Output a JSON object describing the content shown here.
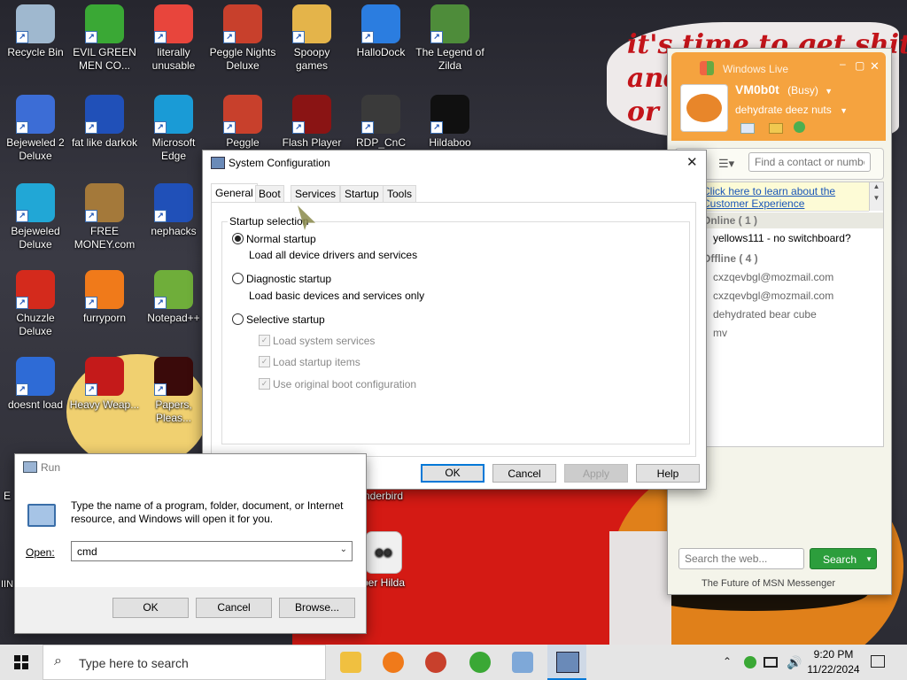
{
  "wallpaper": {
    "text": "it's time to get shit\nand\nor t"
  },
  "desktop_icons": [
    {
      "label": "Recycle Bin",
      "icon": "recycle-bin-icon",
      "color": "#9fb8cf"
    },
    {
      "label": "EVIL GREEN MEN CO...",
      "icon": "msn-people-icon",
      "color": "#3aa835"
    },
    {
      "label": "literally unusable",
      "icon": "chrome-icon",
      "color": "#e8453c"
    },
    {
      "label": "Peggle Nights Deluxe",
      "icon": "peggle-icon",
      "color": "#c8402c"
    },
    {
      "label": "Spoopy games",
      "icon": "folder-icon",
      "color": "#e4b44a"
    },
    {
      "label": "HalloDock",
      "icon": "windows-shield-icon",
      "color": "#2b7de0"
    },
    {
      "label": "The Legend of Zilda",
      "icon": "zilda-icon",
      "color": "#4e8c3a"
    },
    {
      "label": "Bejeweled 2 Deluxe",
      "icon": "bejeweled-icon",
      "color": "#3c6dd6"
    },
    {
      "label": "fat like darkok",
      "icon": "mpi-icon",
      "color": "#2050b8"
    },
    {
      "label": "Microsoft Edge",
      "icon": "edge-icon",
      "color": "#1a9bd6"
    },
    {
      "label": "Peggle World...",
      "icon": "peggle-world-icon",
      "color": "#c8402c"
    },
    {
      "label": "Flash Player",
      "icon": "flash-icon",
      "color": "#8a1414"
    },
    {
      "label": "RDP_CnC",
      "icon": "rdp-icon",
      "color": "#3a3a3a"
    },
    {
      "label": "Hildaboo",
      "icon": "yashma-icon",
      "color": "#101010"
    },
    {
      "label": "Bejeweled Deluxe",
      "icon": "gem-icon",
      "color": "#21a7d6"
    },
    {
      "label": "FREE MONEY.com",
      "icon": "money-bag-icon",
      "color": "#a4793a"
    },
    {
      "label": "nephacks",
      "icon": "mpi-blue-icon",
      "color": "#2050b8"
    },
    {
      "label": "Chuzzle Deluxe",
      "icon": "chuzzle-icon",
      "color": "#d42a1c"
    },
    {
      "label": "furryporn",
      "icon": "firefox-icon",
      "color": "#f07a1a"
    },
    {
      "label": "Notepad++",
      "icon": "notepadpp-icon",
      "color": "#6fae3a"
    },
    {
      "label": "doesnt load",
      "icon": "thunderbird-icon",
      "color": "#2e6bd6"
    },
    {
      "label": "Heavy Weap...",
      "icon": "radiation-icon",
      "color": "#c41a1a"
    },
    {
      "label": "Papers, Pleas...",
      "icon": "papers-icon",
      "color": "#3a0a0a"
    }
  ],
  "partial_labels": {
    "thunderbird": "nderbird",
    "hilda": "per Hilda",
    "left1": "E",
    "left2": "IIN"
  },
  "msconfig": {
    "title": "System Configuration",
    "tabs": [
      "General",
      "Boot",
      "Services",
      "Startup",
      "Tools"
    ],
    "active_tab": "General",
    "group_label": "Startup selection",
    "options": [
      {
        "label": "Normal startup",
        "desc": "Load all device drivers and services",
        "checked": true
      },
      {
        "label": "Diagnostic startup",
        "desc": "Load basic devices and services only",
        "checked": false
      },
      {
        "label": "Selective startup",
        "desc": "",
        "checked": false
      }
    ],
    "sub_options": [
      "Load system services",
      "Load startup items",
      "Use original boot configuration"
    ],
    "buttons": {
      "ok": "OK",
      "cancel": "Cancel",
      "apply": "Apply",
      "help": "Help"
    }
  },
  "run": {
    "title": "Run",
    "description": "Type the name of a program, folder, document, or Internet resource, and Windows will open it for you.",
    "open_label": "Open:",
    "value": "cmd",
    "buttons": {
      "ok": "OK",
      "cancel": "Cancel",
      "browse": "Browse..."
    }
  },
  "msn": {
    "app_title": "Windows Live",
    "user": "VM0b0t",
    "status": "(Busy)",
    "personal_message": "dehydrate deez nuts",
    "search_contacts_placeholder": "Find a contact or number...",
    "banner_line1": "Click here to learn about the",
    "banner_line2": "Customer Experience",
    "online_header": "Online ( 1 )",
    "online_contacts": [
      "yellows111 - no switchboard?"
    ],
    "offline_header": "Offline ( 4 )",
    "offline_contacts": [
      "cxzqevbgl@mozmail.com",
      "cxzqevbgl@mozmail.com",
      "dehydrated bear cube",
      "mv"
    ],
    "web_search_placeholder": "Search the web...",
    "search_button": "Search",
    "footer": "The Future of MSN Messenger"
  },
  "taskbar": {
    "search_placeholder": "Type here to search",
    "time": "9:20 PM",
    "date": "11/22/2024"
  }
}
